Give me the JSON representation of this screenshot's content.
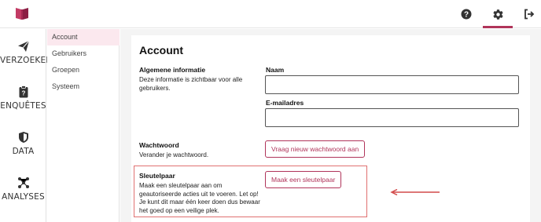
{
  "colors": {
    "brand": "#b0345a",
    "highlight": "#e07070",
    "arrow": "#d24a4a",
    "active_subnav_bg": "#fbe8ee"
  },
  "topbar": {
    "logo_icon": "book-logo-icon",
    "icons": [
      "help-icon",
      "settings-gear-icon",
      "logout-icon"
    ],
    "active": "settings-gear-icon"
  },
  "left_nav": {
    "items": [
      {
        "label": "VERZOEKEN",
        "icon": "paper-plane-icon"
      },
      {
        "label": "ENQUÊTES",
        "icon": "survey-clipboard-icon"
      },
      {
        "label": "DATA",
        "icon": "shield-icon"
      },
      {
        "label": "ANALYSES",
        "icon": "network-icon"
      }
    ]
  },
  "sub_nav": {
    "items": [
      {
        "label": "Account",
        "active": true
      },
      {
        "label": "Gebruikers",
        "active": false
      },
      {
        "label": "Groepen",
        "active": false
      },
      {
        "label": "Systeem",
        "active": false
      }
    ]
  },
  "main": {
    "title": "Account",
    "general": {
      "title": "Algemene informatie",
      "description": "Deze informatie is zichtbaar voor alle gebruikers.",
      "name_label": "Naam",
      "name_value": "",
      "email_label": "E-mailadres",
      "email_value": ""
    },
    "password": {
      "title": "Wachtwoord",
      "description": "Verander je wachtwoord.",
      "button_label": "Vraag nieuw wachtwoord aan"
    },
    "keypair": {
      "title": "Sleutelpaar",
      "description": "Maak een sleutelpaar aan om geautoriseerde acties uit te voeren. Let op! Je kunt dit maar één keer doen dus bewaar het goed op een veilige plek.",
      "button_label": "Maak een sleutelpaar"
    }
  }
}
